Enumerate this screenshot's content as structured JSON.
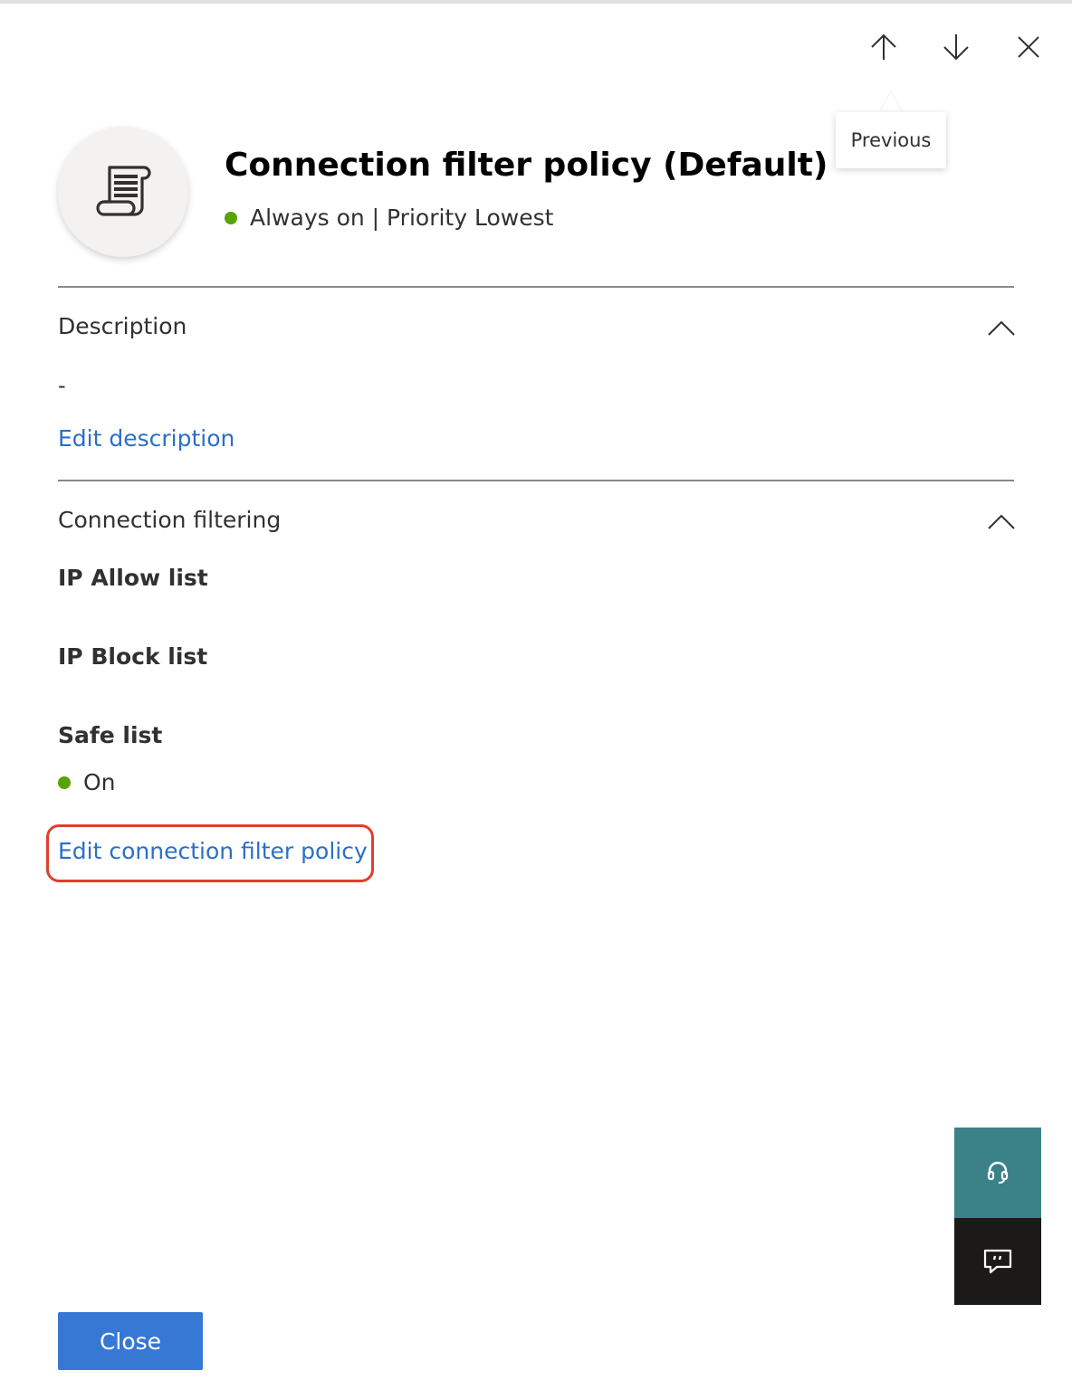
{
  "header": {
    "title": "Connection filter policy (Default)",
    "status": "Always on | Priority Lowest",
    "status_color": "#57a300",
    "icon": "scroll-policy-icon"
  },
  "nav": {
    "previous_icon": "arrow-up-icon",
    "next_icon": "arrow-down-icon",
    "close_icon": "close-icon",
    "tooltip": "Previous"
  },
  "description_section": {
    "title": "Description",
    "value": "-",
    "edit_link": "Edit description"
  },
  "connection_section": {
    "title": "Connection filtering",
    "ip_allow_label": "IP Allow list",
    "ip_block_label": "IP Block list",
    "safe_list_label": "Safe list",
    "safe_list_value": "On",
    "safe_list_status_color": "#57a300",
    "edit_link": "Edit connection filter policy"
  },
  "floating": {
    "help_icon": "headset-icon",
    "feedback_icon": "feedback-icon"
  },
  "footer": {
    "close_label": "Close"
  },
  "colors": {
    "link": "#2b6fc5",
    "primary_button": "#3778d4",
    "highlight": "#e03e2d"
  }
}
